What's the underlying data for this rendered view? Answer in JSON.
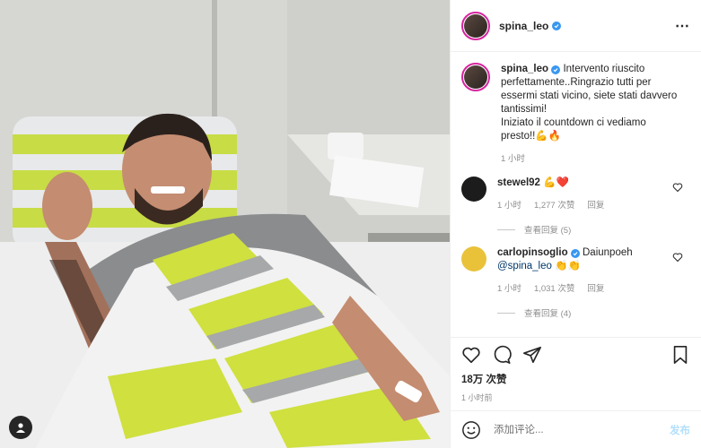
{
  "post": {
    "username": "spina_leo",
    "caption_lines": [
      "Intervento riuscito perfettamente..Ringrazio tutti per essermi stati vicino, siete stati davvero tantissimi!",
      "Iniziato il countdown ci vediamo presto!!💪🔥"
    ],
    "time_ago": "1 小时",
    "likes": "18万 次赞",
    "posted": "1 小时前"
  },
  "comments": [
    {
      "username": "stewel92",
      "text": "💪❤️",
      "time": "1 小时",
      "likes": "1,277 次赞",
      "reply_label": "回复",
      "view_replies": "查看回复 (5)",
      "avatar_color": "#1c1c1c"
    },
    {
      "username": "carlopinsoglio",
      "text": "Daiunpoeh",
      "mention": "@spina_leo",
      "emoji": "👏👏",
      "time": "1 小时",
      "likes": "1,031 次赞",
      "reply_label": "回复",
      "view_replies": "查看回复 (4)",
      "avatar_color": "#e9c23a"
    }
  ],
  "add_comment": {
    "placeholder": "添加评论...",
    "post_label": "发布"
  },
  "icons": {
    "more": "more-options-icon",
    "like": "heart-icon",
    "comment": "comment-icon",
    "share": "share-icon",
    "save": "bookmark-icon",
    "emoji": "emoji-icon",
    "tag": "user-tag-icon"
  },
  "colors": {
    "verified": "#3897f0",
    "accent_link": "#00376b",
    "post_button_disabled": "#b2dffc",
    "muted": "#8e8e8e"
  }
}
